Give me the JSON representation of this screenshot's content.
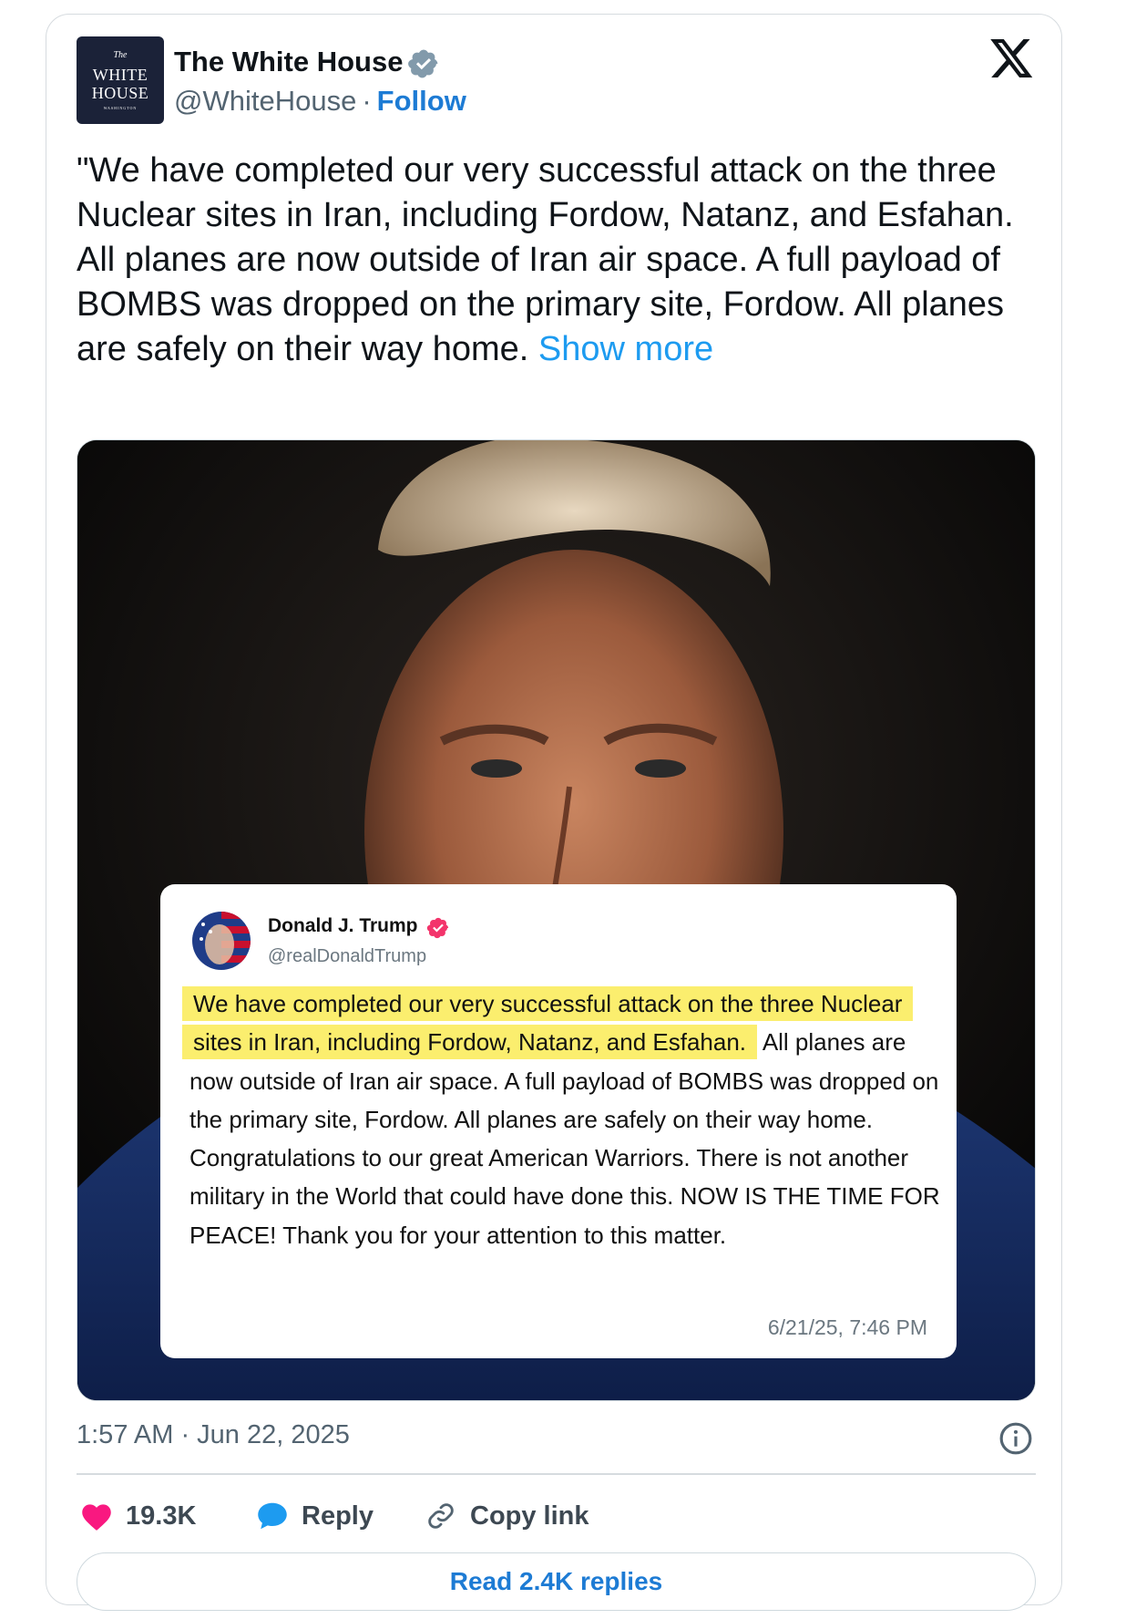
{
  "account": {
    "display_name": "The White House",
    "handle": "@WhiteHouse",
    "separator": "·",
    "follow_label": "Follow",
    "logo_lines": [
      "The",
      "WHITE",
      "HOUSE",
      "WASHINGTON"
    ]
  },
  "tweet": {
    "text": "\"We have completed our very successful attack on the three Nuclear sites in Iran, including Fordow, Natanz, and Esfahan. All planes are now outside of Iran air space. A full payload of BOMBS was dropped on the primary site, Fordow. All planes are safely on their way home. ",
    "show_more": "Show more",
    "timestamp": "1:57 AM · Jun 22, 2025"
  },
  "quoted_post": {
    "name": "Donald J. Trump",
    "handle": "@realDonaldTrump",
    "highlighted_text": "We have completed our very successful attack on the three Nuclear sites in Iran, including Fordow, Natanz, and Esfahan.",
    "body_text": "All planes are now outside of Iran air space. A full payload of BOMBS was dropped on the primary site, Fordow. All planes are safely on their way home. Congratulations to our great American Warriors. There is not another military in the World that could have done this. NOW IS THE TIME FOR PEACE! Thank you for your attention to this matter.",
    "time": "6/21/25, 7:46 PM"
  },
  "actions": {
    "likes": "19.3K",
    "reply_label": "Reply",
    "copy_label": "Copy link",
    "read_replies_label": "Read 2.4K replies"
  },
  "icons": {
    "verified": "verified-badge-icon",
    "x_logo": "x-logo-icon",
    "info": "info-icon",
    "like": "heart-icon",
    "reply": "speech-bubble-icon",
    "copy": "link-icon"
  },
  "colors": {
    "accent_blue": "#1d9bf0",
    "link_blue": "#1d7bd4",
    "heart_pink": "#f91880",
    "highlight_yellow": "#fbee6e",
    "quote_badge_pink": "#f3346b"
  }
}
